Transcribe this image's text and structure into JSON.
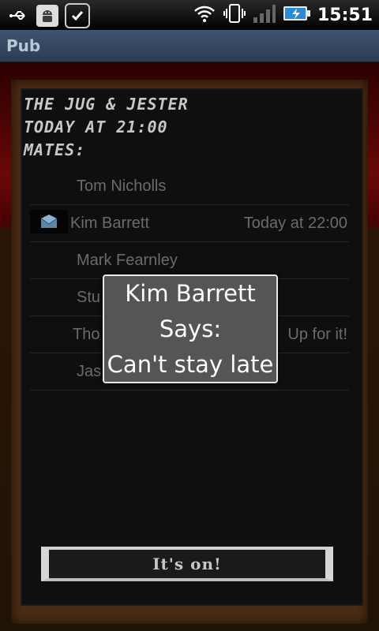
{
  "status_bar": {
    "time": "15:51",
    "icons": [
      "usb-icon",
      "android-debug-icon",
      "checkmark-icon",
      "wifi-icon",
      "vibrate-icon",
      "signal-icon",
      "battery-charging-icon"
    ]
  },
  "app": {
    "title": "Pub"
  },
  "event": {
    "venue": "The Jug & Jester",
    "time": "Today at 21:00",
    "mates_label": "Mates:"
  },
  "mates": [
    {
      "name": "Tom Nicholls",
      "status": ""
    },
    {
      "name": "Kim Barrett",
      "status": "Today at 22:00",
      "has_message": true
    },
    {
      "name": "Mark Fearnley",
      "status": ""
    },
    {
      "name": "Stu",
      "status": ""
    },
    {
      "name": "Tho",
      "status": "Up for it!"
    },
    {
      "name": "Jas",
      "status": ""
    }
  ],
  "dialog": {
    "line1": "Kim Barrett",
    "line2": "Says:",
    "line3": "Can't stay late"
  },
  "action_button": {
    "label": "It's on!"
  }
}
